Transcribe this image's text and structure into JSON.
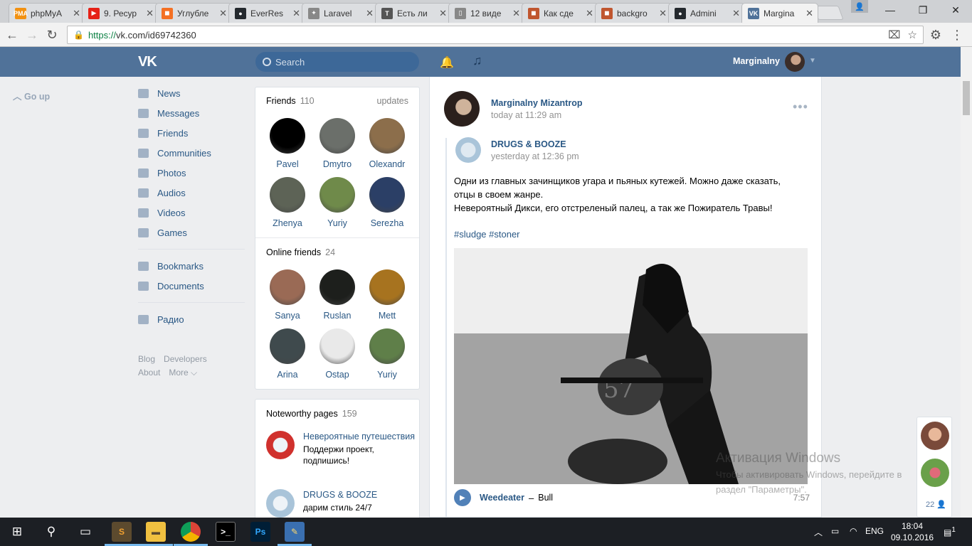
{
  "browser": {
    "tabs": [
      {
        "title": "phpMyA",
        "fav": "PMA",
        "color": "#f29111"
      },
      {
        "title": "9. Ресур",
        "fav": "▶",
        "color": "#e62117"
      },
      {
        "title": "Углубле",
        "fav": "◼",
        "color": "#f47023"
      },
      {
        "title": "EverRes",
        "fav": "●",
        "color": "#24292e"
      },
      {
        "title": "Laravel",
        "fav": "✦",
        "color": "#888"
      },
      {
        "title": "Есть ли",
        "fav": "T",
        "color": "#555"
      },
      {
        "title": "12 виде",
        "fav": "▯",
        "color": "#888"
      },
      {
        "title": "Как сде",
        "fav": "◼",
        "color": "#c0562f"
      },
      {
        "title": "backgro",
        "fav": "◼",
        "color": "#c0562f"
      },
      {
        "title": "Admini",
        "fav": "●",
        "color": "#24292e"
      },
      {
        "title": "Margina",
        "fav": "VK",
        "color": "#507299"
      }
    ],
    "url_scheme": "https://",
    "url_rest": "vk.com/id69742360"
  },
  "header": {
    "search_placeholder": "Search",
    "username": "Marginalny"
  },
  "leftnav": {
    "go_up": "Go up",
    "items": [
      {
        "label": "News",
        "icon": "news-icon"
      },
      {
        "label": "Messages",
        "icon": "messages-icon"
      },
      {
        "label": "Friends",
        "icon": "friends-icon"
      },
      {
        "label": "Communities",
        "icon": "communities-icon"
      },
      {
        "label": "Photos",
        "icon": "photos-icon"
      },
      {
        "label": "Audios",
        "icon": "audios-icon"
      },
      {
        "label": "Videos",
        "icon": "videos-icon"
      },
      {
        "label": "Games",
        "icon": "games-icon"
      }
    ],
    "items2": [
      {
        "label": "Bookmarks",
        "icon": "bookmarks-icon"
      },
      {
        "label": "Documents",
        "icon": "documents-icon"
      }
    ],
    "items3": [
      {
        "label": "Радио",
        "icon": "radio-icon"
      }
    ],
    "footer": {
      "blog": "Blog",
      "developers": "Developers",
      "about": "About",
      "more": "More ⌵"
    }
  },
  "friends": {
    "title": "Friends",
    "count": "110",
    "link": "updates",
    "people": [
      {
        "name": "Pavel",
        "color": "#000000"
      },
      {
        "name": "Dmytro",
        "color": "#6b6f6a"
      },
      {
        "name": "Olexandr",
        "color": "#8c6e4b"
      },
      {
        "name": "Zhenya",
        "color": "#5d6356"
      },
      {
        "name": "Yuriy",
        "color": "#6f8a4a"
      },
      {
        "name": "Serezha",
        "color": "#2b3f66"
      }
    ]
  },
  "online": {
    "title": "Online friends",
    "count": "24",
    "people": [
      {
        "name": "Sanya",
        "color": "#9a6a55"
      },
      {
        "name": "Ruslan",
        "color": "#1d1f1c"
      },
      {
        "name": "Mett",
        "color": "#a7731f"
      },
      {
        "name": "Arina",
        "color": "#3f4a4d"
      },
      {
        "name": "Ostap",
        "color": "#e9e9e9"
      },
      {
        "name": "Yuriy",
        "color": "#5f7f49"
      }
    ]
  },
  "noteworthy": {
    "title": "Noteworthy pages",
    "count": "159",
    "items": [
      {
        "name": "Невероятные путешествия",
        "desc": "Поддержи проект, подпишись!",
        "color": "#d0312d"
      },
      {
        "name": "DRUGS & BOOZE",
        "desc": "дарим стиль 24/7",
        "color": "#a9c4d9"
      }
    ]
  },
  "post": {
    "author": "Marginalny Mizantrop",
    "time": "today at 11:29 am",
    "repost_author": "DRUGS & BOOZE",
    "repost_time": "yesterday at 12:36 pm",
    "text_line1": "Одни из главных зачинщиков угара и пьяных кутежей. Можно даже сказать,",
    "text_line2": "отцы в своем жанре.",
    "text_line3": "Невероятный Дикси, его отстреленый палец, а так же Пожиратель Травы!",
    "tags": "#sludge #stoner",
    "audio": {
      "artist": "Weedeater",
      "title": "Bull",
      "duration": "7:57"
    }
  },
  "fastchat": {
    "count": "22"
  },
  "watermark": {
    "line1": "Активация Windows",
    "line2": "Чтобы активировать Windows, перейдите в",
    "line3": "раздел \"Параметры\"."
  },
  "taskbar": {
    "lang": "ENG",
    "time": "18:04",
    "date": "09.10.2016",
    "notif": "1"
  }
}
